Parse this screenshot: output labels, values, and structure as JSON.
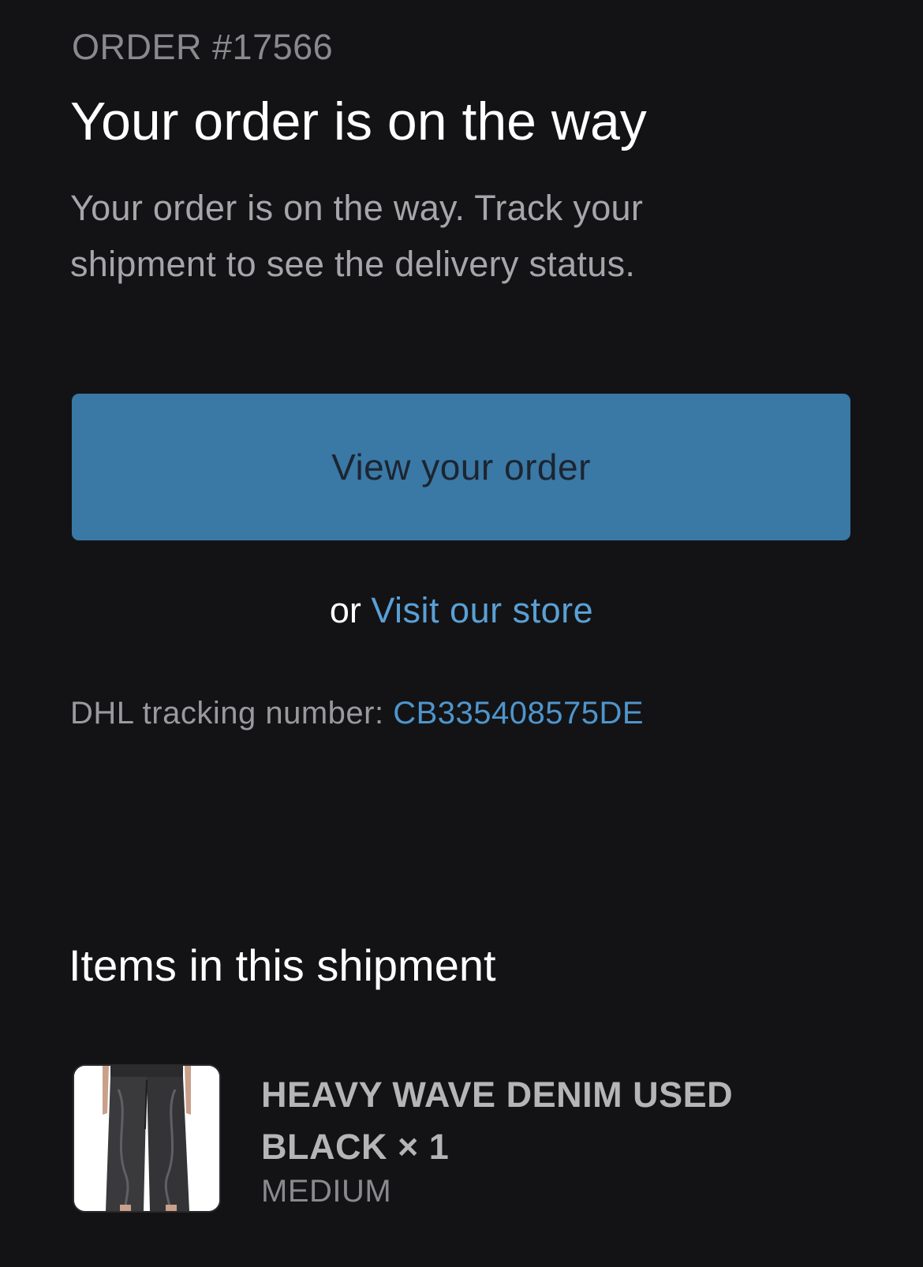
{
  "order": {
    "number_label": "ORDER #17566",
    "title": "Your order is on the way",
    "intro_line1": "Your order is on the way. Track your",
    "intro_line2": "shipment to see the delivery status."
  },
  "actions": {
    "view_order_label": "View your order",
    "or_label": "or",
    "visit_store_label": "Visit our store"
  },
  "tracking": {
    "label": "DHL tracking number:",
    "number": "CB335408575DE"
  },
  "shipment": {
    "section_title": "Items in this shipment",
    "items": [
      {
        "name": "HEAVY WAVE DENIM USED BLACK × 1",
        "variant": "MEDIUM",
        "thumbnail_icon": "black-wide-leg-jeans-photo"
      }
    ]
  },
  "colors": {
    "background": "#131315",
    "button": "#3a78a6",
    "link": "#5aa0d6",
    "muted_text": "#8a8a8e"
  }
}
